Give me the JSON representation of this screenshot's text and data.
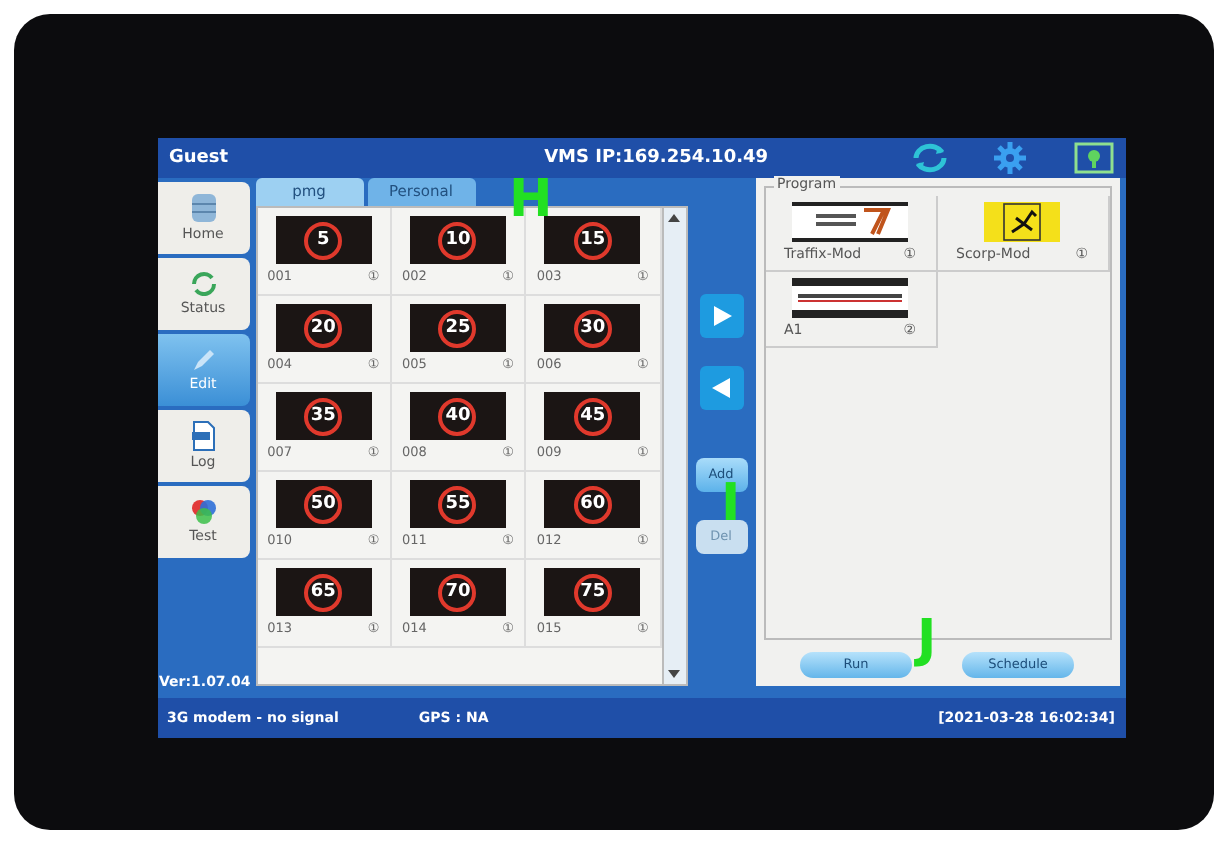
{
  "header": {
    "user": "Guest",
    "title": "VMS IP:169.254.10.49"
  },
  "nav": [
    {
      "label": "Home",
      "selected": false
    },
    {
      "label": "Status",
      "selected": false
    },
    {
      "label": "Edit",
      "selected": true
    },
    {
      "label": "Log",
      "selected": false
    },
    {
      "label": "Test",
      "selected": false
    }
  ],
  "version": "Ver:1.07.04",
  "tabs": [
    {
      "label": "pmg",
      "selected": false
    },
    {
      "label": "Personal",
      "selected": true
    }
  ],
  "signs": [
    {
      "value": "5",
      "code": "001",
      "badge": "①"
    },
    {
      "value": "10",
      "code": "002",
      "badge": "①"
    },
    {
      "value": "15",
      "code": "003",
      "badge": "①"
    },
    {
      "value": "20",
      "code": "004",
      "badge": "①"
    },
    {
      "value": "25",
      "code": "005",
      "badge": "①"
    },
    {
      "value": "30",
      "code": "006",
      "badge": "①"
    },
    {
      "value": "35",
      "code": "007",
      "badge": "①"
    },
    {
      "value": "40",
      "code": "008",
      "badge": "①"
    },
    {
      "value": "45",
      "code": "009",
      "badge": "①"
    },
    {
      "value": "50",
      "code": "010",
      "badge": "①"
    },
    {
      "value": "55",
      "code": "011",
      "badge": "①"
    },
    {
      "value": "60",
      "code": "012",
      "badge": "①"
    },
    {
      "value": "65",
      "code": "013",
      "badge": "①"
    },
    {
      "value": "70",
      "code": "014",
      "badge": "①"
    },
    {
      "value": "75",
      "code": "015",
      "badge": "①"
    }
  ],
  "actions": [
    {
      "label": "Add",
      "disabled": false
    },
    {
      "label": "Del",
      "disabled": true
    }
  ],
  "program": {
    "legend": "Program",
    "items": [
      {
        "name": "Traffix-Mod",
        "badge": "①"
      },
      {
        "name": "Scorp-Mod",
        "badge": "①"
      },
      {
        "name": "A1",
        "badge": "②"
      }
    ],
    "buttons": [
      "Run",
      "Schedule"
    ]
  },
  "status": {
    "modem": "3G modem - no signal",
    "gps": "GPS : NA",
    "time": "[2021-03-28 16:02:34]"
  },
  "annotations": [
    {
      "text": "H"
    },
    {
      "text": "I"
    },
    {
      "text": "J"
    }
  ]
}
